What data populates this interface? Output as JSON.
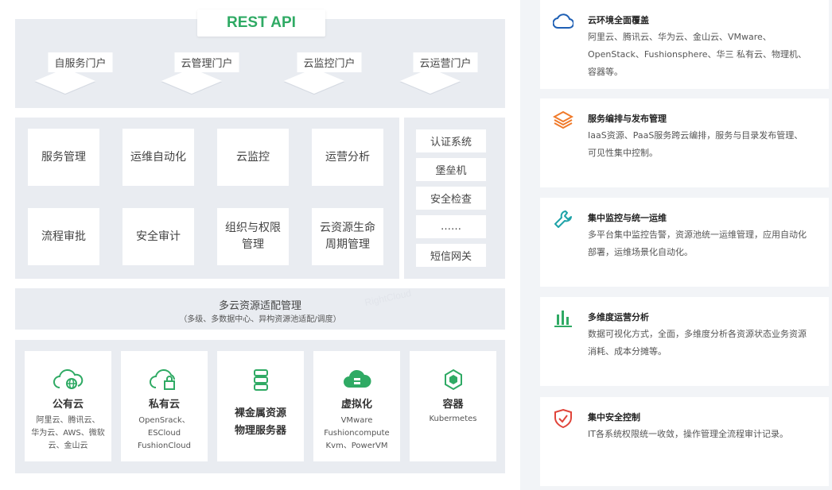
{
  "architecture": {
    "rest_api": "REST API",
    "portals": [
      "自服务门户",
      "云管理门户",
      "云监控门户",
      "云运营门户"
    ],
    "modules": [
      "服务管理",
      "运维自动化",
      "云监控",
      "运营分析",
      "流程审批",
      "安全审计",
      "组织与权限\n管理",
      "云资源生命\n周期管理"
    ],
    "side_systems": [
      "认证系统",
      "堡垒机",
      "安全检查",
      "……",
      "短信网关"
    ],
    "adapter": {
      "title": "多云资源适配管理",
      "subtitle": "（多级、多数据中心、异构资源池适配/调度）",
      "watermark": "RightCloud"
    },
    "resources": [
      {
        "title": "公有云",
        "desc": "阿里云、腾讯云、\n华为云、AWS、微软\n云、金山云",
        "icon": "cloud-globe-icon"
      },
      {
        "title": "私有云",
        "desc": "OpenSrack、ESCloud\nFushionCloud",
        "icon": "cloud-lock-icon"
      },
      {
        "title": "裸金属资源\n物理服务器",
        "desc": "",
        "icon": "server-icon"
      },
      {
        "title": "虚拟化",
        "desc": "VMware\nFushioncompute\nKvm、PowerVM",
        "icon": "cloud-server-icon"
      },
      {
        "title": "容器",
        "desc": "Kubermetes",
        "icon": "container-icon"
      }
    ],
    "colors": {
      "accent": "#2faa64",
      "band": "#e9ecf1"
    }
  },
  "features": [
    {
      "title": "云环境全面覆盖",
      "desc": "阿里云、腾讯云、华为云、金山云、VMware、OpenStack、Fushionsphere、华三 私有云、物理机、容器等。",
      "icon": "cloud-icon",
      "color": "#1e5fb4"
    },
    {
      "title": "服务编排与发布管理",
      "desc": "IaaS资源、PaaS服务跨云编排，服务与目录发布管理、可见性集中控制。",
      "icon": "layers-icon",
      "color": "#f07a2a"
    },
    {
      "title": "集中监控与统一运维",
      "desc": "多平台集中监控告警，资源池统一运维管理，应用自动化部署，运维场景化自动化。",
      "icon": "wrench-icon",
      "color": "#1fa3a8"
    },
    {
      "title": "多维度运营分析",
      "desc": "数据可视化方式，全面，多维度分析各资源状态业务资源消耗、成本分摊等。",
      "icon": "bar-chart-icon",
      "color": "#2faa64"
    },
    {
      "title": "集中安全控制",
      "desc": "IT各系统权限统一收敛，操作管理全流程审计记录。",
      "icon": "shield-check-icon",
      "color": "#e0443a"
    }
  ]
}
